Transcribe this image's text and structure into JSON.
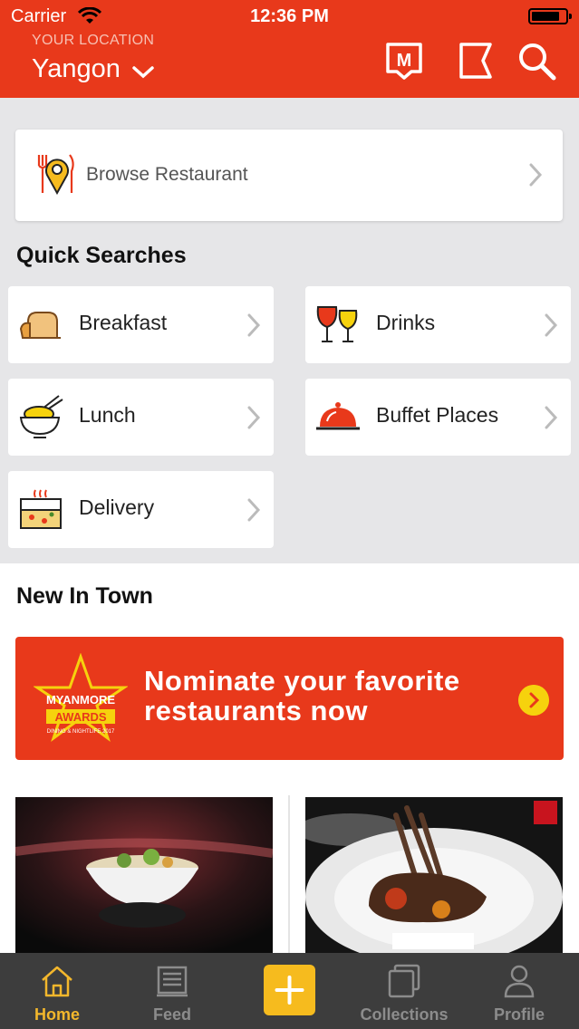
{
  "status": {
    "carrier": "Carrier",
    "time": "12:36 PM"
  },
  "header": {
    "location_label": "YOUR LOCATION",
    "location_value": "Yangon",
    "icon_m_letter": "M",
    "icons": [
      "m-badge-icon",
      "bookmark-icon",
      "search-icon"
    ],
    "accent": "#e8391b"
  },
  "browse": {
    "label": "Browse Restaurant",
    "icon": "map-pin-cutlery-icon"
  },
  "quick_searches": {
    "title": "Quick Searches",
    "items": [
      {
        "label": "Breakfast",
        "icon": "bread-icon"
      },
      {
        "label": "Drinks",
        "icon": "wine-glasses-icon"
      },
      {
        "label": "Lunch",
        "icon": "rice-bowl-icon"
      },
      {
        "label": "Buffet Places",
        "icon": "food-cloche-icon"
      },
      {
        "label": "Delivery",
        "icon": "pizza-box-icon"
      }
    ]
  },
  "new_in_town": {
    "title": "New In Town",
    "banner": {
      "line1": "Nominate your favorite",
      "line2": "restaurants now",
      "logo_text1": "MYANMORE",
      "logo_text2": "AWARDS",
      "logo_text3": "DINING & NIGHTLIFE 2017"
    },
    "photos": [
      "salad-bowl-photo",
      "lamb-chops-photo"
    ]
  },
  "tabs": [
    {
      "label": "Home",
      "icon": "home-icon",
      "active": true
    },
    {
      "label": "Feed",
      "icon": "feed-icon",
      "active": false
    },
    {
      "label": "",
      "icon": "add-icon",
      "active": false
    },
    {
      "label": "Collections",
      "icon": "collections-icon",
      "active": false
    },
    {
      "label": "Profile",
      "icon": "profile-icon",
      "active": false
    }
  ],
  "colors": {
    "accent": "#e8391b",
    "tab_active": "#f3b72c",
    "add_button": "#f6bb1e"
  }
}
